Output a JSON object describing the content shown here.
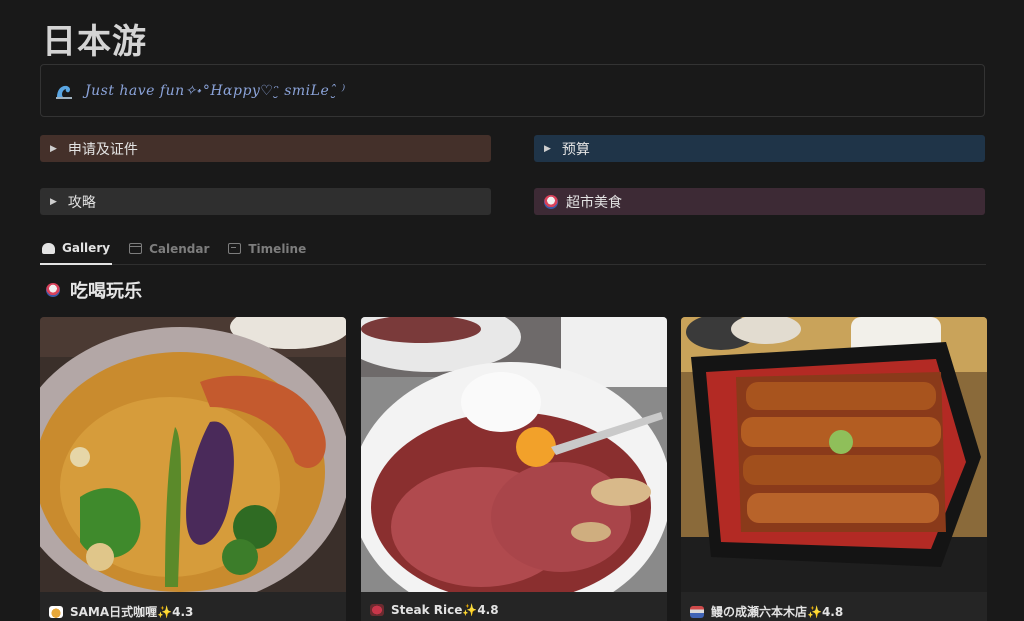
{
  "page": {
    "title": "日本游"
  },
  "callout": {
    "icon": "wave-icon",
    "text": "Just have fun✧˖°Hɑppy♡ᵔ̮ smiLeˆ̮ ⁾"
  },
  "toggles": [
    {
      "label": "申请及证件",
      "color": "#44302a"
    },
    {
      "label": "预算",
      "color": "#1f3448"
    },
    {
      "label": "攻略",
      "color": "#2f2f2f"
    },
    {
      "label": "超市美食",
      "color": "#3d2a35"
    }
  ],
  "tabs": [
    {
      "label": "Gallery",
      "icon": "gallery-icon",
      "active": true
    },
    {
      "label": "Calendar",
      "icon": "calendar-icon",
      "active": false
    },
    {
      "label": "Timeline",
      "icon": "timeline-icon",
      "active": false
    }
  ],
  "section": {
    "title": "吃喝玩乐",
    "icon": "sushi-icon"
  },
  "cards": [
    {
      "title": "SAMA日式咖喱✨4.3",
      "icon": "curry-icon"
    },
    {
      "title": "Steak Rice✨4.8",
      "icon": "meat-icon"
    },
    {
      "title": "鳗の成瀬六本木店✨4.8",
      "icon": "tokyo-tower-icon"
    }
  ]
}
